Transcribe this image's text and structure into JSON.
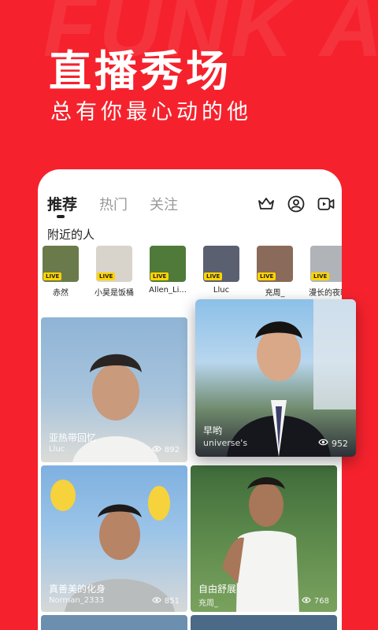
{
  "watermark": "FUNK A",
  "hero": {
    "title": "直播秀场",
    "subtitle": "总有你最心动的他"
  },
  "tabs": [
    {
      "label": "推荐",
      "active": true
    },
    {
      "label": "热门",
      "active": false
    },
    {
      "label": "关注",
      "active": false
    }
  ],
  "icons": [
    "crown-icon",
    "profile-icon",
    "video-icon"
  ],
  "nearby": {
    "title": "附近的人",
    "live_label": "LIVE",
    "people": [
      {
        "name": "赤然",
        "color": "#6b7a4a"
      },
      {
        "name": "小昊是饭桶",
        "color": "#d8d4cc"
      },
      {
        "name": "Allen_Li...",
        "color": "#4f7a3a"
      },
      {
        "name": "Lluc",
        "color": "#5a6070"
      },
      {
        "name": "充周_",
        "color": "#8a6a5a"
      },
      {
        "name": "漫长的夜晚",
        "color": "#b0b4b8"
      }
    ]
  },
  "cards": [
    {
      "title": "亚热带回忆",
      "user": "Lluc",
      "views": "892"
    },
    {
      "title": "早哟",
      "user": "universe's",
      "views": "952"
    },
    {
      "title": "真善美的化身",
      "user": "Norman_2333",
      "views": "851"
    },
    {
      "title": "自由舒展",
      "user": "充周_",
      "views": "768"
    }
  ]
}
